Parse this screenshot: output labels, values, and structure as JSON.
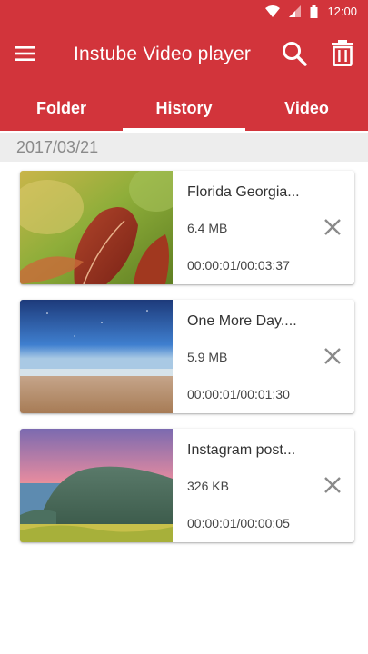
{
  "status_bar": {
    "time": "12:00"
  },
  "app_bar": {
    "title": "Instube Video player",
    "icons": [
      "menu-icon",
      "search-icon",
      "trash-icon"
    ]
  },
  "tabs": [
    {
      "label": "Folder",
      "active": false
    },
    {
      "label": "History",
      "active": true
    },
    {
      "label": "Video",
      "active": false
    }
  ],
  "history": {
    "date": "2017/03/21",
    "items": [
      {
        "name": "Florida Georgia...",
        "size": "6.4 MB",
        "time": "00:00:01/00:03:37"
      },
      {
        "name": "One More Day....",
        "size": "5.9 MB",
        "time": "00:00:01/00:01:30"
      },
      {
        "name": "Instagram post...",
        "size": "326 KB",
        "time": "00:00:01/00:00:05"
      }
    ]
  },
  "colors": {
    "accent": "#d2343b",
    "date_header_bg": "#ededed"
  }
}
